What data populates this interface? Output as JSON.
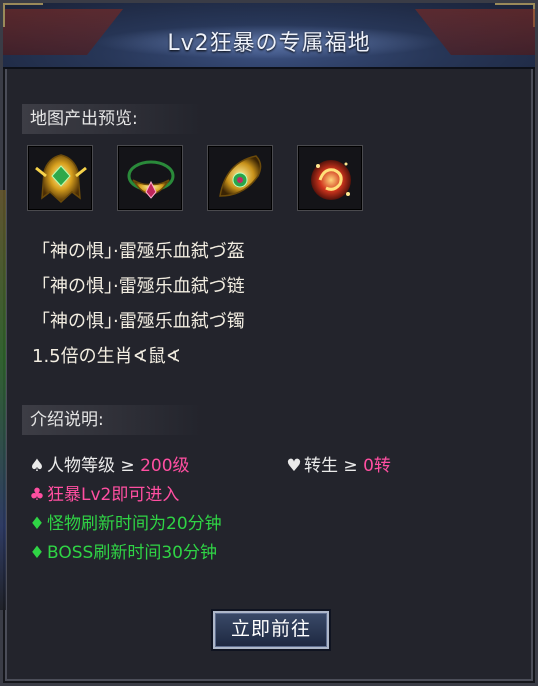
{
  "window": {
    "title": "Lv2狂暴の专属福地"
  },
  "drops": {
    "label": "地图产出预览:",
    "items": [
      {
        "icon": "golden-helmet-icon"
      },
      {
        "icon": "golden-necklace-icon"
      },
      {
        "icon": "golden-bracelet-icon"
      },
      {
        "icon": "red-zodiac-rat-icon"
      }
    ],
    "lines": [
      "「神の惧」·雷殛乐血弑づ盔",
      "「神の惧」·雷殛乐血弑づ链",
      "「神の惧」·雷殛乐血弑づ镯",
      "1.5倍の生肖∢鼠∢"
    ]
  },
  "intro": {
    "label": "介绍说明:",
    "level_suit": "♠",
    "level_text": "人物等级 ≥ ",
    "level_value": "200级",
    "rebirth_suit": "♥",
    "rebirth_text": "转生 ≥ ",
    "rebirth_value": "0转",
    "entry_suit": "♣",
    "entry_text": "狂暴Lv2即可进入",
    "refresh_suit": "♦",
    "refresh_text": "怪物刷新时间为20分钟",
    "boss_suit": "♦",
    "boss_text": "BOSS刷新时间30分钟"
  },
  "actions": {
    "go_label": "立即前往"
  },
  "colors": {
    "pink": "#ff4fa1",
    "green": "#2fd445",
    "text": "#f2ede1"
  }
}
